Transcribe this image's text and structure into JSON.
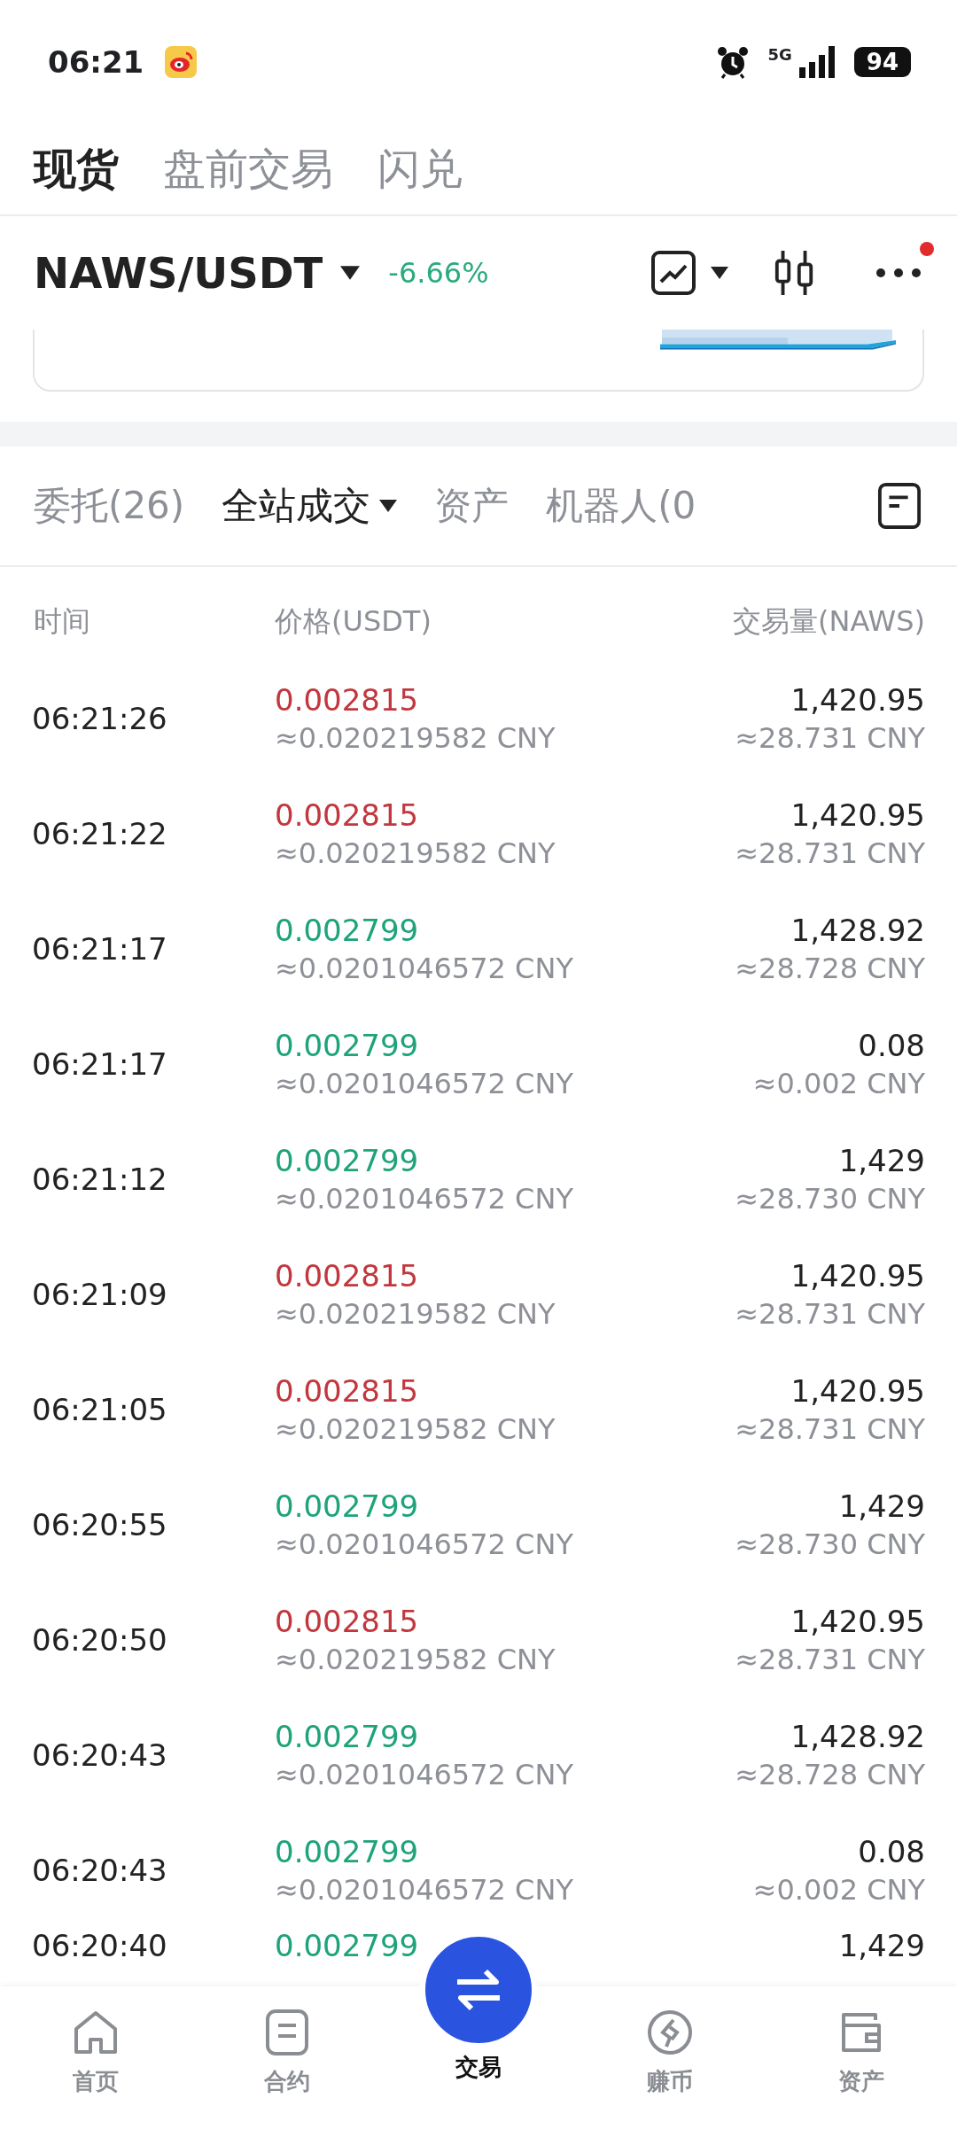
{
  "status_bar": {
    "time": "06:21",
    "network": "5G",
    "battery": "94"
  },
  "top_tabs": [
    {
      "label": "现货",
      "selected": true
    },
    {
      "label": "盘前交易",
      "selected": false
    },
    {
      "label": "闪兑",
      "selected": false
    }
  ],
  "pair": {
    "symbol": "NAWS/USDT",
    "change": "-6.66%",
    "notification": true
  },
  "trade_tabs": [
    {
      "label": "委托(26)",
      "selected": false,
      "has_menu": false
    },
    {
      "label": "全站成交",
      "selected": true,
      "has_menu": true
    },
    {
      "label": "资产",
      "selected": false,
      "has_menu": false
    },
    {
      "label": "机器人(0",
      "selected": false,
      "has_menu": false
    }
  ],
  "columns": [
    "时间",
    "价格(USDT)",
    "交易量(NAWS)"
  ],
  "trades": [
    {
      "time": "06:21:26",
      "price": "0.002815",
      "price_cny": "≈0.020219582 CNY",
      "amount": "1,420.95",
      "amount_cny": "≈28.731 CNY",
      "color": "#c2373d"
    },
    {
      "time": "06:21:22",
      "price": "0.002815",
      "price_cny": "≈0.020219582 CNY",
      "amount": "1,420.95",
      "amount_cny": "≈28.731 CNY",
      "color": "#c2373d"
    },
    {
      "time": "06:21:17",
      "price": "0.002799",
      "price_cny": "≈0.0201046572 CNY",
      "amount": "1,428.92",
      "amount_cny": "≈28.728 CNY",
      "color": "#1ea37a"
    },
    {
      "time": "06:21:17",
      "price": "0.002799",
      "price_cny": "≈0.0201046572 CNY",
      "amount": "0.08",
      "amount_cny": "≈0.002 CNY",
      "color": "#1ea37a"
    },
    {
      "time": "06:21:12",
      "price": "0.002799",
      "price_cny": "≈0.0201046572 CNY",
      "amount": "1,429",
      "amount_cny": "≈28.730 CNY",
      "color": "#1ea37a"
    },
    {
      "time": "06:21:09",
      "price": "0.002815",
      "price_cny": "≈0.020219582 CNY",
      "amount": "1,420.95",
      "amount_cny": "≈28.731 CNY",
      "color": "#c2373d"
    },
    {
      "time": "06:21:05",
      "price": "0.002815",
      "price_cny": "≈0.020219582 CNY",
      "amount": "1,420.95",
      "amount_cny": "≈28.731 CNY",
      "color": "#c2373d"
    },
    {
      "time": "06:20:55",
      "price": "0.002799",
      "price_cny": "≈0.0201046572 CNY",
      "amount": "1,429",
      "amount_cny": "≈28.730 CNY",
      "color": "#1ea37a"
    },
    {
      "time": "06:20:50",
      "price": "0.002815",
      "price_cny": "≈0.020219582 CNY",
      "amount": "1,420.95",
      "amount_cny": "≈28.731 CNY",
      "color": "#c2373d"
    },
    {
      "time": "06:20:43",
      "price": "0.002799",
      "price_cny": "≈0.0201046572 CNY",
      "amount": "1,428.92",
      "amount_cny": "≈28.728 CNY",
      "color": "#1ea37a"
    },
    {
      "time": "06:20:43",
      "price": "0.002799",
      "price_cny": "≈0.0201046572 CNY",
      "amount": "0.08",
      "amount_cny": "≈0.002 CNY",
      "color": "#1ea37a"
    },
    {
      "time": "06:20:40",
      "price": "0.002799",
      "amount": "1,429",
      "color": "#1ea37a"
    }
  ],
  "nav": [
    {
      "label": "首页",
      "selected": false
    },
    {
      "label": "合约",
      "selected": false
    },
    {
      "label": "交易",
      "selected": true
    },
    {
      "label": "赚币",
      "selected": false
    },
    {
      "label": "资产",
      "selected": false
    }
  ]
}
